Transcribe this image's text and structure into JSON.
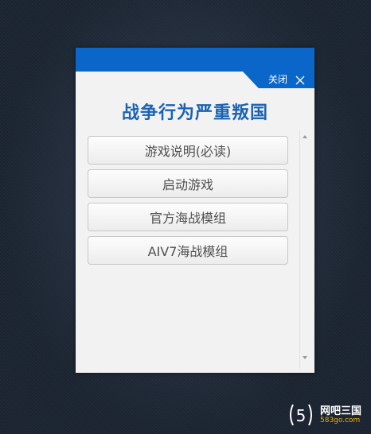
{
  "window": {
    "close_label": "关闭",
    "title": "战争行为严重叛国",
    "menu": [
      "游戏说明(必读)",
      "启动游戏",
      "官方海战模组",
      "AIV7海战模组"
    ]
  },
  "watermark": {
    "logo_glyph": "5",
    "name": "网吧三国",
    "site": "583go.com"
  },
  "colors": {
    "accent": "#0a67c9",
    "title": "#1b63b4",
    "watermark_sub": "#f0b400"
  },
  "icons": [
    "close-icon",
    "scroll-up-arrow-icon",
    "scroll-down-arrow-icon",
    "watermark-logo-icon"
  ]
}
